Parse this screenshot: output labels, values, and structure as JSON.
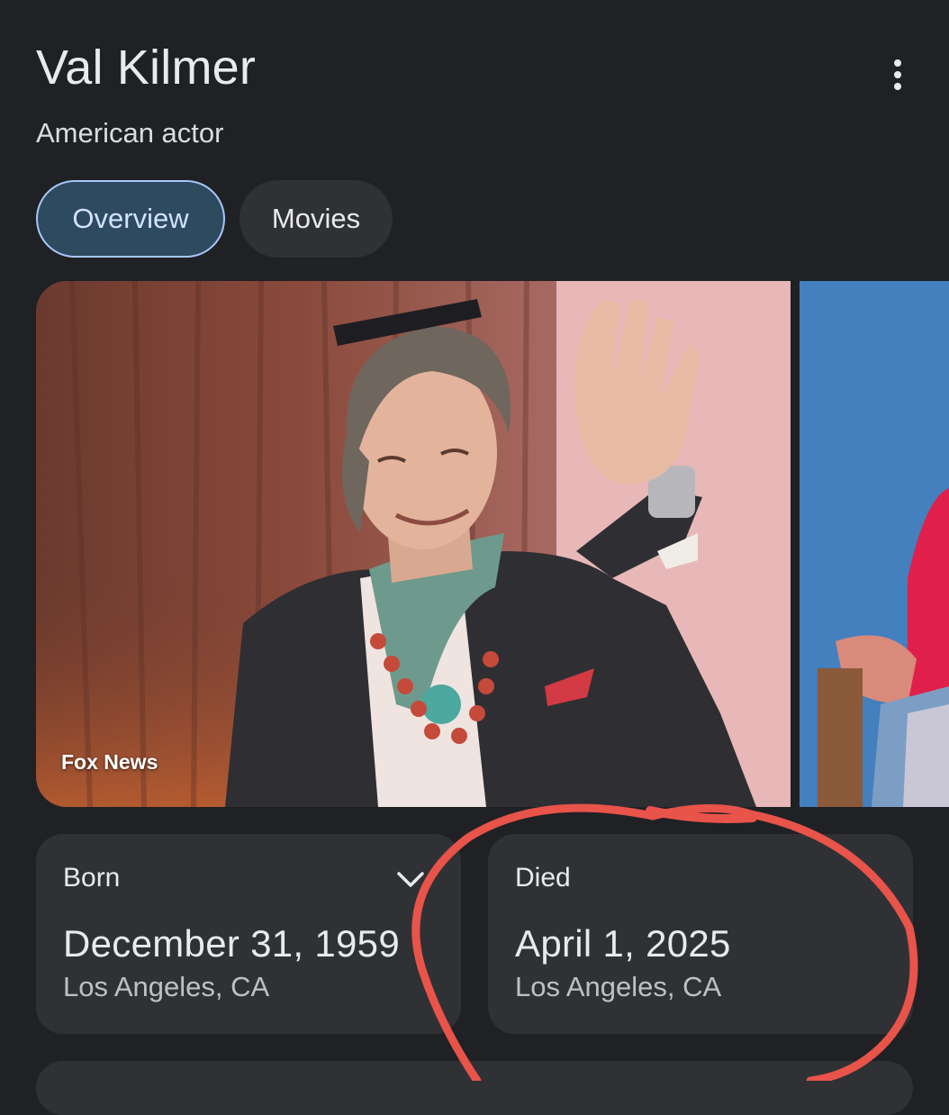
{
  "header": {
    "title": "Val Kilmer",
    "subtitle": "American actor",
    "more_icon": "more-vert-icon"
  },
  "tabs": [
    {
      "label": "Overview",
      "selected": true
    },
    {
      "label": "Movies",
      "selected": false
    }
  ],
  "images": {
    "main_source": "Fox News"
  },
  "facts": {
    "born": {
      "label": "Born",
      "date": "December 31, 1959",
      "place": "Los Angeles, CA",
      "expand_icon": "chevron-down-icon"
    },
    "died": {
      "label": "Died",
      "date": "April 1, 2025",
      "place": "Los Angeles, CA"
    }
  },
  "colors": {
    "background": "#202124",
    "card": "#303134",
    "selected_tab_bg": "#2e4a5f",
    "selected_tab_border": "#a8c7fa",
    "annotation": "#e8534a"
  }
}
